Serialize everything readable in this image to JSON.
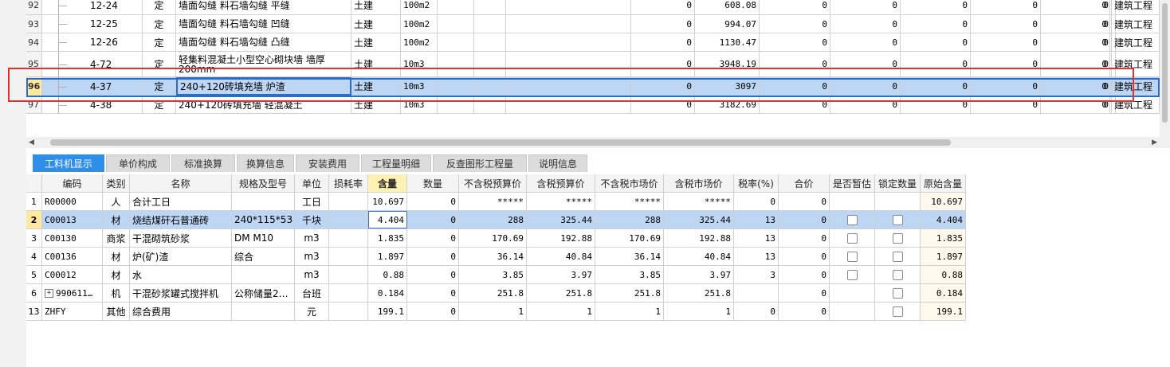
{
  "top_rows": [
    {
      "no": "92",
      "code": "12-24",
      "type": "定",
      "name": "墙面勾缝 料石墙勾缝 平缝",
      "major": "土建",
      "unit": "100m2",
      "v1": "0",
      "v2": "608.08",
      "v3": "0",
      "v4": "0",
      "v5": "0",
      "v6": "0",
      "v7": "0",
      "v8": "0",
      "cat": "建筑工程"
    },
    {
      "no": "93",
      "code": "12-25",
      "type": "定",
      "name": "墙面勾缝 料石墙勾缝 凹缝",
      "major": "土建",
      "unit": "100m2",
      "v1": "0",
      "v2": "994.07",
      "v3": "0",
      "v4": "0",
      "v5": "0",
      "v6": "0",
      "v7": "0",
      "v8": "0",
      "cat": "建筑工程"
    },
    {
      "no": "94",
      "code": "12-26",
      "type": "定",
      "name": "墙面勾缝 料石墙勾缝 凸缝",
      "major": "土建",
      "unit": "100m2",
      "v1": "0",
      "v2": "1130.47",
      "v3": "0",
      "v4": "0",
      "v5": "0",
      "v6": "0",
      "v7": "0",
      "v8": "0",
      "cat": "建筑工程"
    },
    {
      "no": "95",
      "code": "4-72",
      "type": "定",
      "name": "轻集料混凝土小型空心砌块墙 墙厚200mm",
      "major": "土建",
      "unit": "10m3",
      "v1": "0",
      "v2": "3948.19",
      "v3": "0",
      "v4": "0",
      "v5": "0",
      "v6": "0",
      "v7": "0",
      "v8": "0",
      "cat": "建筑工程"
    },
    {
      "no": "96",
      "code": "4-37",
      "type": "定",
      "name": "240+120砖填充墙 炉渣",
      "major": "土建",
      "unit": "10m3",
      "v1": "0",
      "v2": "3097",
      "v3": "0",
      "v4": "0",
      "v5": "0",
      "v6": "0",
      "v7": "0",
      "v8": "0",
      "cat": "建筑工程"
    },
    {
      "no": "97",
      "code": "4-38",
      "type": "定",
      "name": "240+120砖填充墙 轻混凝土",
      "major": "土建",
      "unit": "10m3",
      "v1": "0",
      "v2": "3182.69",
      "v3": "0",
      "v4": "0",
      "v5": "0",
      "v6": "0",
      "v7": "0",
      "v8": "0",
      "cat": "建筑工程"
    }
  ],
  "tabs": [
    "工料机显示",
    "单价构成",
    "标准换算",
    "换算信息",
    "安装费用",
    "工程量明细",
    "反查图形工程量",
    "说明信息"
  ],
  "bottom_headers": [
    "",
    "编码",
    "类别",
    "名称",
    "规格及型号",
    "单位",
    "损耗率",
    "含量",
    "数量",
    "不含税预算价",
    "含税预算价",
    "不含税市场价",
    "含税市场价",
    "税率(%)",
    "合价",
    "是否暂估",
    "锁定数量",
    "原始含量"
  ],
  "bottom_rows": [
    {
      "no": "1",
      "code": "R00000",
      "type": "人",
      "name": "合计工日",
      "spec": "",
      "unit": "工日",
      "loss": "",
      "qty_per": "10.697",
      "qty": "0",
      "p1": "*****",
      "p2": "*****",
      "p3": "*****",
      "p4": "*****",
      "tax": "0",
      "total": "0",
      "est": false,
      "lock": false,
      "orig": "10.697",
      "expand": false
    },
    {
      "no": "2",
      "code": "C00013",
      "type": "材",
      "name": "烧结煤矸石普通砖",
      "spec": "240*115*53",
      "unit": "千块",
      "loss": "",
      "qty_per": "4.404",
      "qty": "0",
      "p1": "288",
      "p2": "325.44",
      "p3": "288",
      "p4": "325.44",
      "tax": "13",
      "total": "0",
      "est": true,
      "lock": true,
      "orig": "4.404",
      "expand": false
    },
    {
      "no": "3",
      "code": "C00130",
      "type": "商浆",
      "name": "干混砌筑砂浆",
      "spec": "DM M10",
      "unit": "m3",
      "loss": "",
      "qty_per": "1.835",
      "qty": "0",
      "p1": "170.69",
      "p2": "192.88",
      "p3": "170.69",
      "p4": "192.88",
      "tax": "13",
      "total": "0",
      "est": true,
      "lock": true,
      "orig": "1.835",
      "expand": false
    },
    {
      "no": "4",
      "code": "C00136",
      "type": "材",
      "name": "炉(矿)渣",
      "spec": "综合",
      "unit": "m3",
      "loss": "",
      "qty_per": "1.897",
      "qty": "0",
      "p1": "36.14",
      "p2": "40.84",
      "p3": "36.14",
      "p4": "40.84",
      "tax": "13",
      "total": "0",
      "est": true,
      "lock": true,
      "orig": "1.897",
      "expand": false
    },
    {
      "no": "5",
      "code": "C00012",
      "type": "材",
      "name": "水",
      "spec": "",
      "unit": "m3",
      "loss": "",
      "qty_per": "0.88",
      "qty": "0",
      "p1": "3.85",
      "p2": "3.97",
      "p3": "3.85",
      "p4": "3.97",
      "tax": "3",
      "total": "0",
      "est": true,
      "lock": true,
      "orig": "0.88",
      "expand": false
    },
    {
      "no": "6",
      "code": "990611…",
      "type": "机",
      "name": "干混砂浆罐式搅拌机",
      "spec": "公称储量2…",
      "unit": "台班",
      "loss": "",
      "qty_per": "0.184",
      "qty": "0",
      "p1": "251.8",
      "p2": "251.8",
      "p3": "251.8",
      "p4": "251.8",
      "tax": "",
      "total": "0",
      "est": false,
      "lock": true,
      "orig": "0.184",
      "expand": true
    },
    {
      "no": "13",
      "code": "ZHFY",
      "type": "其他",
      "name": "综合费用",
      "spec": "",
      "unit": "元",
      "loss": "",
      "qty_per": "199.1",
      "qty": "0",
      "p1": "1",
      "p2": "1",
      "p3": "1",
      "p4": "1",
      "tax": "0",
      "total": "0",
      "est": false,
      "lock": true,
      "orig": "199.1",
      "expand": false
    }
  ]
}
